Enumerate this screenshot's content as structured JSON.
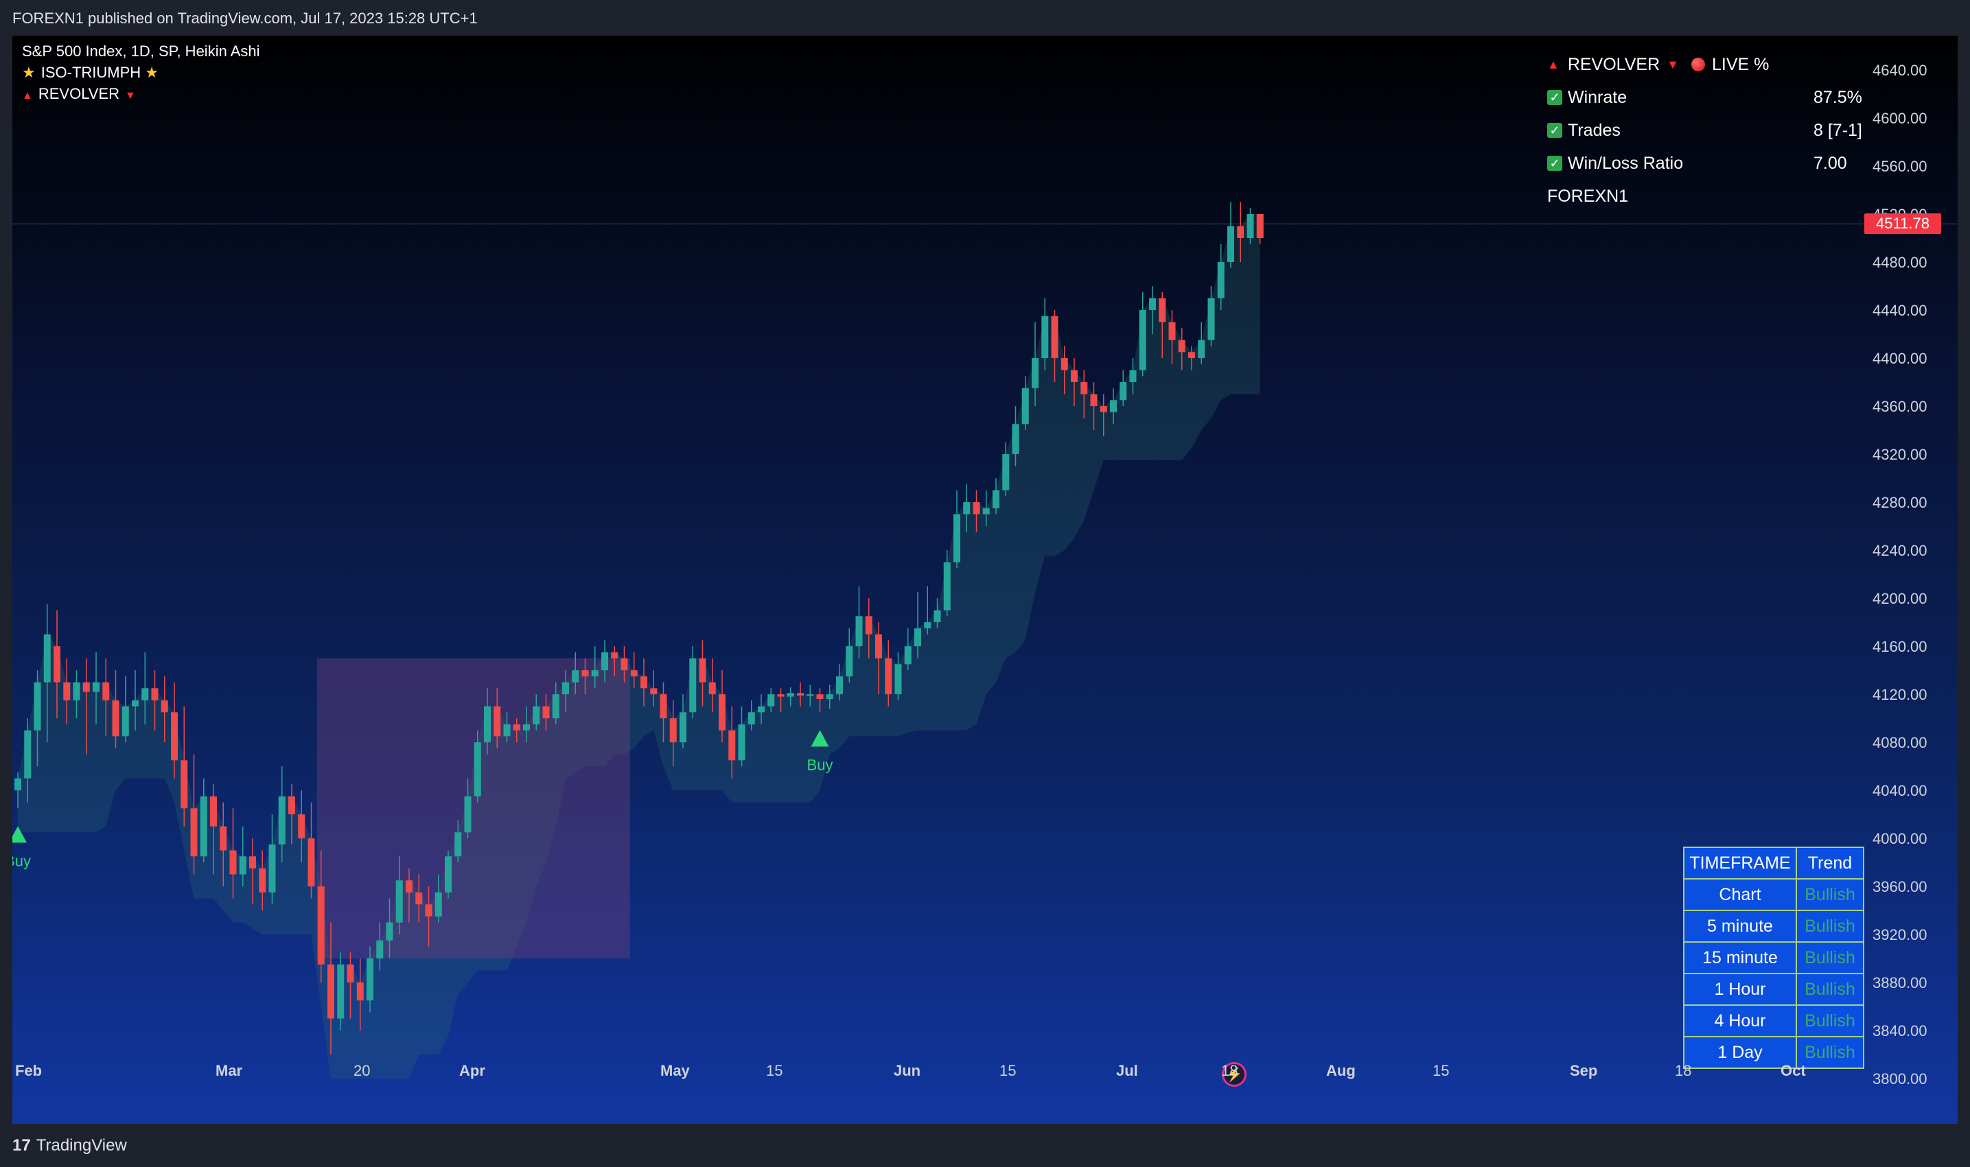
{
  "header": {
    "published_text": "FOREXN1 published on TradingView.com, Jul 17, 2023 15:28 UTC+1"
  },
  "footer": {
    "brand": "TradingView"
  },
  "legend": {
    "symbol_line": "S&P 500 Index, 1D, SP, Heikin Ashi",
    "indicator1": "ISO-TRIUMPH",
    "indicator2": "REVOLVER"
  },
  "stats": {
    "title": "REVOLVER",
    "live_label": "LIVE %",
    "rows": [
      {
        "label": "Winrate",
        "value": "87.5%"
      },
      {
        "label": "Trades",
        "value": "8 [7-1]"
      },
      {
        "label": "Win/Loss Ratio",
        "value": "7.00"
      }
    ],
    "author": "FOREXN1"
  },
  "trend_table": {
    "headers": [
      "TIMEFRAME",
      "Trend"
    ],
    "rows": [
      [
        "Chart",
        "Bullish"
      ],
      [
        "5 minute",
        "Bullish"
      ],
      [
        "15 minute",
        "Bullish"
      ],
      [
        "1 Hour",
        "Bullish"
      ],
      [
        "4 Hour",
        "Bullish"
      ],
      [
        "1 Day",
        "Bullish"
      ]
    ]
  },
  "current_price": "4511.78",
  "colors": {
    "up": "#26a69a",
    "down": "#f04a4a",
    "buy": "#2bd97a",
    "price_tag": "#f23645"
  },
  "chart_data": {
    "type": "candlestick",
    "title": "S&P 500 Index, 1D, SP, Heikin Ashi",
    "ylim": [
      3800,
      4640
    ],
    "y_ticks": [
      "4640.00",
      "4600.00",
      "4560.00",
      "4520.00",
      "4480.00",
      "4440.00",
      "4400.00",
      "4360.00",
      "4320.00",
      "4280.00",
      "4240.00",
      "4200.00",
      "4160.00",
      "4120.00",
      "4080.00",
      "4040.00",
      "4000.00",
      "3960.00",
      "3920.00",
      "3880.00",
      "3840.00",
      "3800.00"
    ],
    "x_ticks": [
      {
        "label": "Feb",
        "bold": true
      },
      {
        "label": "Mar",
        "bold": true
      },
      {
        "label": "20",
        "bold": false
      },
      {
        "label": "Apr",
        "bold": true
      },
      {
        "label": "May",
        "bold": true
      },
      {
        "label": "15",
        "bold": false
      },
      {
        "label": "Jun",
        "bold": true
      },
      {
        "label": "15",
        "bold": false
      },
      {
        "label": "Jul",
        "bold": true
      },
      {
        "label": "18",
        "bold": false
      },
      {
        "label": "Aug",
        "bold": true
      },
      {
        "label": "15",
        "bold": false
      },
      {
        "label": "Sep",
        "bold": true
      },
      {
        "label": "18",
        "bold": false
      },
      {
        "label": "Oct",
        "bold": true
      }
    ],
    "candles": [
      [
        4040,
        4050,
        4025,
        4055
      ],
      [
        4050,
        4090,
        4030,
        4100
      ],
      [
        4090,
        4130,
        4060,
        4140
      ],
      [
        4130,
        4170,
        4080,
        4195
      ],
      [
        4160,
        4130,
        4100,
        4190
      ],
      [
        4130,
        4115,
        4095,
        4150
      ],
      [
        4115,
        4130,
        4100,
        4140
      ],
      [
        4130,
        4122,
        4070,
        4150
      ],
      [
        4122,
        4130,
        4095,
        4155
      ],
      [
        4130,
        4115,
        4085,
        4150
      ],
      [
        4115,
        4085,
        4075,
        4140
      ],
      [
        4085,
        4110,
        4080,
        4135
      ],
      [
        4110,
        4115,
        4090,
        4140
      ],
      [
        4115,
        4125,
        4095,
        4155
      ],
      [
        4125,
        4115,
        4090,
        4140
      ],
      [
        4115,
        4105,
        4080,
        4135
      ],
      [
        4105,
        4065,
        4050,
        4130
      ],
      [
        4065,
        4025,
        4010,
        4110
      ],
      [
        4025,
        3985,
        3970,
        4070
      ],
      [
        3985,
        4035,
        3980,
        4050
      ],
      [
        4035,
        4010,
        3970,
        4045
      ],
      [
        4010,
        3990,
        3960,
        4030
      ],
      [
        3990,
        3970,
        3950,
        4025
      ],
      [
        3970,
        3985,
        3960,
        4010
      ],
      [
        3985,
        3975,
        3945,
        4000
      ],
      [
        3975,
        3955,
        3940,
        3990
      ],
      [
        3955,
        3995,
        3945,
        4020
      ],
      [
        3995,
        4035,
        3980,
        4060
      ],
      [
        4035,
        4020,
        3995,
        4045
      ],
      [
        4020,
        4000,
        3980,
        4040
      ],
      [
        4000,
        3960,
        3950,
        4030
      ],
      [
        3960,
        3895,
        3880,
        3990
      ],
      [
        3895,
        3850,
        3820,
        3930
      ],
      [
        3850,
        3895,
        3840,
        3905
      ],
      [
        3895,
        3880,
        3850,
        3905
      ],
      [
        3880,
        3865,
        3840,
        3900
      ],
      [
        3865,
        3900,
        3855,
        3910
      ],
      [
        3900,
        3915,
        3890,
        3930
      ],
      [
        3915,
        3930,
        3900,
        3950
      ],
      [
        3930,
        3965,
        3920,
        3985
      ],
      [
        3965,
        3955,
        3930,
        3975
      ],
      [
        3955,
        3945,
        3930,
        3970
      ],
      [
        3945,
        3935,
        3910,
        3960
      ],
      [
        3935,
        3955,
        3930,
        3970
      ],
      [
        3955,
        3985,
        3950,
        3990
      ],
      [
        3985,
        4005,
        3980,
        4015
      ],
      [
        4005,
        4035,
        4000,
        4050
      ],
      [
        4035,
        4080,
        4030,
        4090
      ],
      [
        4080,
        4110,
        4070,
        4125
      ],
      [
        4110,
        4085,
        4075,
        4125
      ],
      [
        4085,
        4095,
        4080,
        4105
      ],
      [
        4095,
        4090,
        4080,
        4100
      ],
      [
        4090,
        4095,
        4080,
        4110
      ],
      [
        4095,
        4110,
        4090,
        4120
      ],
      [
        4110,
        4100,
        4090,
        4120
      ],
      [
        4100,
        4120,
        4095,
        4130
      ],
      [
        4120,
        4130,
        4105,
        4140
      ],
      [
        4130,
        4140,
        4120,
        4155
      ],
      [
        4140,
        4135,
        4120,
        4150
      ],
      [
        4135,
        4140,
        4125,
        4160
      ],
      [
        4140,
        4155,
        4130,
        4165
      ],
      [
        4155,
        4150,
        4135,
        4160
      ],
      [
        4150,
        4140,
        4130,
        4160
      ],
      [
        4140,
        4135,
        4125,
        4155
      ],
      [
        4135,
        4125,
        4110,
        4150
      ],
      [
        4125,
        4120,
        4110,
        4140
      ],
      [
        4120,
        4100,
        4080,
        4130
      ],
      [
        4100,
        4080,
        4060,
        4115
      ],
      [
        4080,
        4105,
        4075,
        4120
      ],
      [
        4105,
        4150,
        4100,
        4160
      ],
      [
        4150,
        4130,
        4110,
        4165
      ],
      [
        4130,
        4120,
        4105,
        4150
      ],
      [
        4120,
        4090,
        4080,
        4140
      ],
      [
        4090,
        4065,
        4050,
        4110
      ],
      [
        4065,
        4095,
        4060,
        4110
      ],
      [
        4095,
        4105,
        4090,
        4115
      ],
      [
        4105,
        4110,
        4095,
        4120
      ],
      [
        4110,
        4120,
        4105,
        4125
      ],
      [
        4120,
        4118,
        4105,
        4125
      ],
      [
        4118,
        4121,
        4110,
        4126
      ],
      [
        4121,
        4119,
        4110,
        4130
      ],
      [
        4119,
        4120,
        4110,
        4128
      ],
      [
        4120,
        4116,
        4105,
        4125
      ],
      [
        4116,
        4120,
        4108,
        4128
      ],
      [
        4120,
        4135,
        4115,
        4145
      ],
      [
        4135,
        4160,
        4130,
        4175
      ],
      [
        4160,
        4185,
        4150,
        4210
      ],
      [
        4185,
        4170,
        4150,
        4200
      ],
      [
        4170,
        4150,
        4120,
        4180
      ],
      [
        4150,
        4120,
        4110,
        4165
      ],
      [
        4120,
        4145,
        4115,
        4155
      ],
      [
        4145,
        4160,
        4140,
        4175
      ],
      [
        4160,
        4175,
        4150,
        4205
      ],
      [
        4175,
        4180,
        4170,
        4210
      ],
      [
        4180,
        4190,
        4175,
        4200
      ],
      [
        4190,
        4230,
        4185,
        4240
      ],
      [
        4230,
        4270,
        4225,
        4290
      ],
      [
        4270,
        4280,
        4255,
        4295
      ],
      [
        4280,
        4270,
        4255,
        4290
      ],
      [
        4270,
        4275,
        4260,
        4290
      ],
      [
        4275,
        4290,
        4270,
        4300
      ],
      [
        4290,
        4320,
        4285,
        4330
      ],
      [
        4320,
        4345,
        4310,
        4360
      ],
      [
        4345,
        4375,
        4340,
        4385
      ],
      [
        4375,
        4400,
        4360,
        4430
      ],
      [
        4400,
        4435,
        4390,
        4450
      ],
      [
        4435,
        4400,
        4380,
        4440
      ],
      [
        4400,
        4390,
        4370,
        4410
      ],
      [
        4390,
        4380,
        4360,
        4400
      ],
      [
        4380,
        4370,
        4350,
        4390
      ],
      [
        4370,
        4360,
        4340,
        4380
      ],
      [
        4360,
        4355,
        4335,
        4370
      ],
      [
        4355,
        4365,
        4345,
        4375
      ],
      [
        4365,
        4380,
        4360,
        4390
      ],
      [
        4380,
        4390,
        4370,
        4400
      ],
      [
        4390,
        4440,
        4385,
        4455
      ],
      [
        4440,
        4450,
        4420,
        4460
      ],
      [
        4450,
        4430,
        4400,
        4455
      ],
      [
        4430,
        4415,
        4395,
        4440
      ],
      [
        4415,
        4405,
        4390,
        4425
      ],
      [
        4405,
        4400,
        4390,
        4410
      ],
      [
        4400,
        4415,
        4395,
        4430
      ],
      [
        4415,
        4450,
        4410,
        4460
      ],
      [
        4450,
        4480,
        4440,
        4495
      ],
      [
        4480,
        4510,
        4475,
        4530
      ],
      [
        4510,
        4500,
        4480,
        4530
      ],
      [
        4500,
        4520,
        4495,
        4525
      ],
      [
        4520,
        4500,
        4495,
        4520
      ]
    ],
    "signals": [
      {
        "type": "Buy",
        "bar": 0
      },
      {
        "type": "Buy",
        "bar": 82
      }
    ]
  }
}
